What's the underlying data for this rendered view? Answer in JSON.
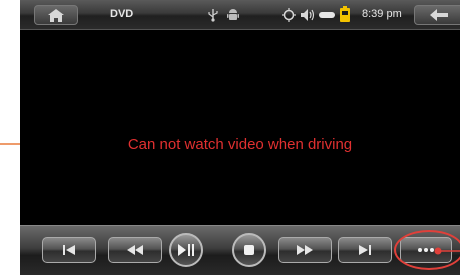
{
  "status_bar": {
    "title": "DVD",
    "time": "8:39 pm"
  },
  "icons": {
    "home": "home-icon",
    "usb": "usb-icon",
    "android": "android-icon",
    "brightness": "brightness-icon",
    "volume": "volume-icon",
    "battery": "battery-icon",
    "back": "back-arrow-icon"
  },
  "video": {
    "warning": "Can not watch video when driving"
  },
  "controls": {
    "buttons": [
      "previous",
      "rewind",
      "play-pause",
      "stop",
      "fast-forward",
      "next",
      "more"
    ]
  },
  "colors": {
    "warning_text": "#e03030",
    "annotation": "#e0403a",
    "battery": "#f2c200"
  }
}
